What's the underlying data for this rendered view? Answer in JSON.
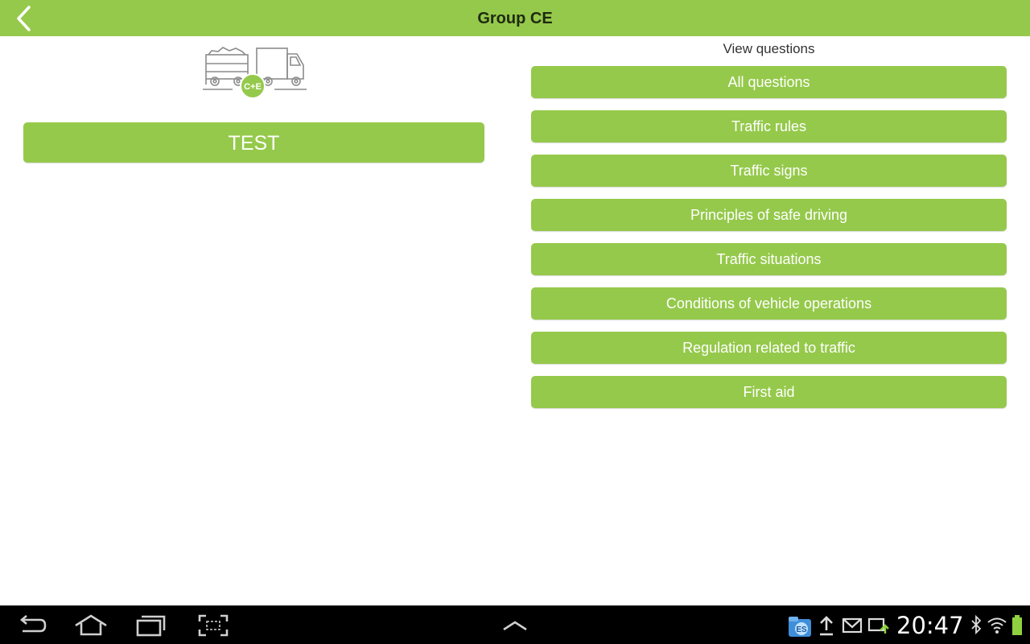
{
  "header": {
    "title": "Group CE",
    "back_icon": "chevron-left-icon"
  },
  "left_panel": {
    "vehicle_icon": "truck-with-trailer-icon",
    "badge_text": "C+E",
    "test_button_label": "TEST"
  },
  "right_panel": {
    "section_label": "View questions",
    "question_buttons": [
      "All questions",
      "Traffic rules",
      "Traffic signs",
      "Principles of safe driving",
      "Traffic situations",
      "Conditions of vehicle operations",
      "Regulation related to traffic",
      "First aid"
    ]
  },
  "system_bar": {
    "clock": "20:47",
    "nav_icons": [
      "back-icon",
      "home-icon",
      "recent-apps-icon",
      "screenshot-icon",
      "chevron-up-icon"
    ],
    "status_icons": [
      "file-manager-icon",
      "upload-icon",
      "mail-icon",
      "sync-icon",
      "bluetooth-icon",
      "wifi-icon",
      "battery-icon"
    ]
  },
  "colors": {
    "accent": "#95c94b",
    "button_text": "#ffffff",
    "title_text": "#1f2a10",
    "system_bar": "#000000",
    "battery": "#8fd13f"
  }
}
